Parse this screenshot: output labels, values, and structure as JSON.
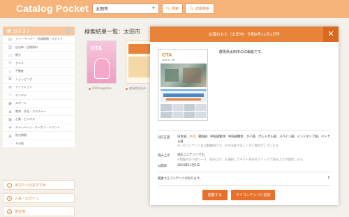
{
  "header": {
    "logo": "Catalog Pocket",
    "search_value": "太田市",
    "search_button": "検索",
    "detail_search_button": "詳細検索"
  },
  "sidebar": {
    "category_heading": "カテゴリ",
    "categories": [
      {
        "label": "フリーペーパー・地域情報・メディア",
        "icon": "newspaper-icon"
      },
      {
        "label": "自治体・広報資料",
        "icon": "building-icon"
      },
      {
        "label": "観光",
        "icon": "map-icon"
      },
      {
        "label": "グルメ",
        "icon": "fork-knife-icon"
      },
      {
        "label": "不動産",
        "icon": "house-icon"
      },
      {
        "label": "ショッピング",
        "icon": "bag-icon"
      },
      {
        "label": "ファッション",
        "icon": "shirt-icon"
      },
      {
        "label": "エンタメ",
        "icon": "star-icon"
      },
      {
        "label": "スポーツ",
        "icon": "ball-icon"
      },
      {
        "label": "教育・文化・カルチャー",
        "icon": "graduation-icon"
      },
      {
        "label": "企業・ビジネス",
        "icon": "briefcase-icon"
      },
      {
        "label": "キャンペーン・クーポン・イベント",
        "icon": "ticket-icon"
      },
      {
        "label": "防災情報",
        "icon": "warning-icon"
      },
      {
        "label": "その他",
        "icon": "dots-icon"
      }
    ],
    "recommend_label": "あなたへのおすすめ",
    "login_label": "入会・ログイン",
    "region_label": "現在地"
  },
  "results": {
    "title": "検索結果一覧：太田市",
    "items": [
      {
        "caption": "OTAmagazine"
      },
      {
        "caption": "群馬県太田市"
      }
    ]
  },
  "modal": {
    "title": "広報おおた（太田市）令和6年11月1日号",
    "close_glyph": "✕",
    "cover_logo": "OTA",
    "cover_date": "2024.11.1号",
    "description": "群馬県太田市の広報紙です。",
    "meta": {
      "languages_label": "対応言語",
      "languages_value_pre": "日本語、",
      "languages_link": "手話",
      "languages_value_post": "、韓国語、中国語繁体、中国語簡体、タイ語、ポルトガル語、スペイン語、インドネシア語、ベトナム語",
      "languages_note": "※このコンテンツは自動翻訳です。その内容が正しくない場合がございます。",
      "readaloud_label": "読み上げ",
      "readaloud_value": "対応コンテンツです。",
      "readaloud_note": "※閲覧時の下部ツール「読み上げ」を選択しテキスト部分をクリックで読み上げが開始します。",
      "published_label": "公開日",
      "published_value": "2024年11月1日"
    },
    "related_label": "関連するコンテンツがあります。",
    "read_button": "閲覧する",
    "add_button": "マイコンテンツに追加"
  },
  "colors": {
    "header": "#f7b47a",
    "accent": "#e8833a",
    "button": "#e8702a"
  }
}
